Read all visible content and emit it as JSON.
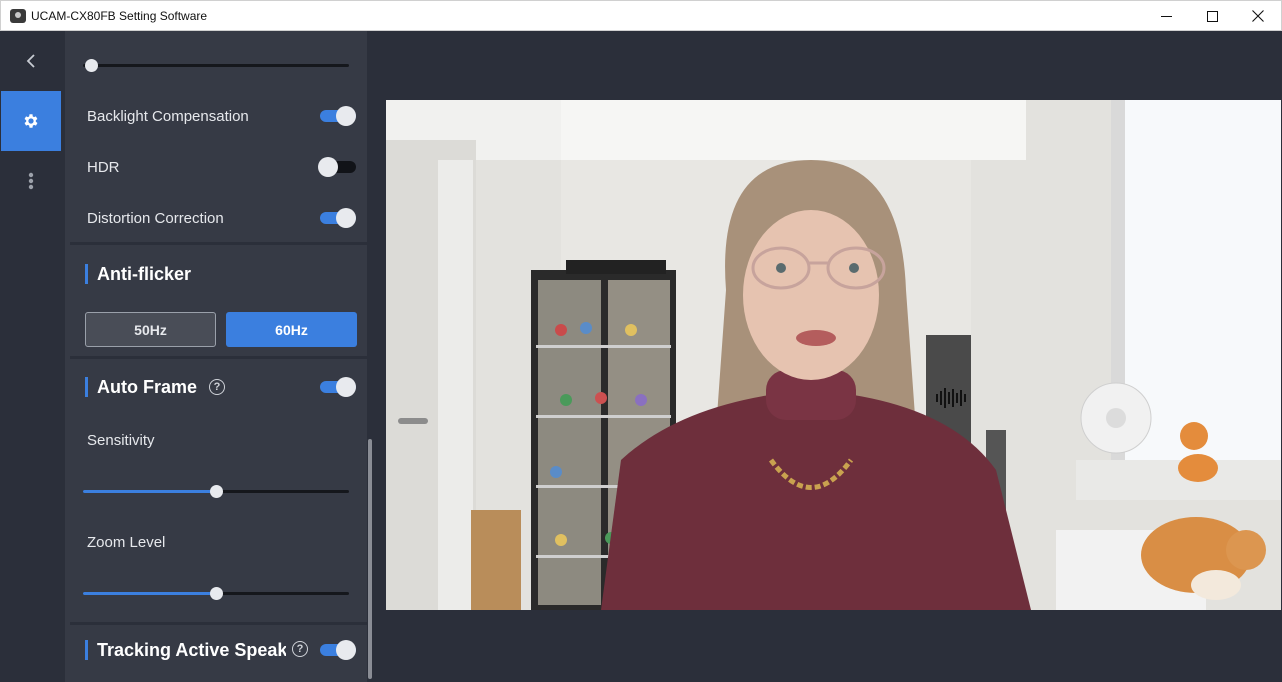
{
  "window": {
    "title": "UCAM-CX80FB Setting Software",
    "controls": {
      "minimize": "—",
      "maximize": "☐",
      "close": "✕"
    }
  },
  "nav": {
    "back_icon": "chevron-left-icon",
    "settings_icon": "gear-icon",
    "more_icon": "more-vertical-icon"
  },
  "settings": {
    "top_slider": {
      "value_fraction": 0.0
    },
    "backlight_compensation": {
      "label": "Backlight Compensation",
      "on": true
    },
    "hdr": {
      "label": "HDR",
      "on": false
    },
    "distortion_correction": {
      "label": "Distortion Correction",
      "on": true
    },
    "anti_flicker": {
      "title": "Anti-flicker",
      "options": [
        "50Hz",
        "60Hz"
      ],
      "selected": "60Hz"
    },
    "auto_frame": {
      "title": "Auto Frame",
      "help": "?",
      "on": true,
      "sensitivity": {
        "label": "Sensitivity",
        "value_fraction": 0.5
      },
      "zoom_level": {
        "label": "Zoom Level",
        "value_fraction": 0.5
      }
    },
    "tracking_active_speaker": {
      "title": "Tracking Active Speaker",
      "help": "?",
      "on": true
    }
  },
  "colors": {
    "accent": "#3b7fdf",
    "panel": "#363a45",
    "background": "#2b2f3a"
  }
}
